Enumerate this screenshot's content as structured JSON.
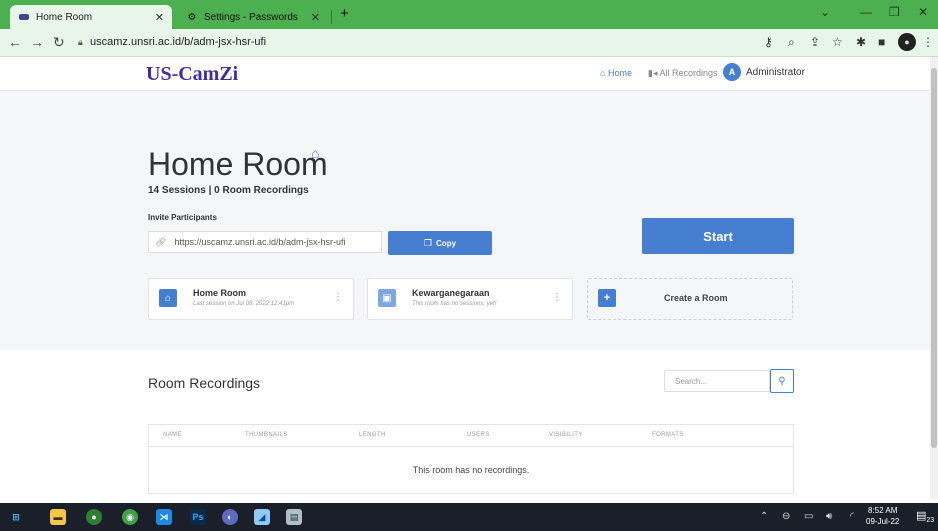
{
  "browser": {
    "tabs": [
      {
        "title": "Home Room",
        "active": true
      },
      {
        "title": "Settings - Passwords",
        "active": false
      }
    ],
    "url": "uscamz.unsri.ac.id/b/adm-jsx-hsr-ufi"
  },
  "header": {
    "logo": "US-CamZi",
    "nav": {
      "home": "Home",
      "recordings": "All Recordings",
      "avatar_initial": "A",
      "user": "Administrator"
    }
  },
  "room": {
    "title": "Home Room",
    "stats": "14 Sessions | 0 Room Recordings",
    "invite_label": "Invite Participants",
    "invite_link": "https://uscamz.unsri.ac.id/b/adm-jsx-hsr-ufi",
    "copy_label": "Copy",
    "start_label": "Start"
  },
  "room_cards": [
    {
      "name": "Home Room",
      "subtitle": "Last session on Jul 08, 2022 12:41pm"
    },
    {
      "name": "Kewarganegaraan",
      "subtitle": "This room has no sessions, yet!"
    }
  ],
  "create_room_label": "Create a Room",
  "recordings": {
    "title": "Room Recordings",
    "search_placeholder": "Search...",
    "columns": [
      "NAME",
      "THUMBNAILS",
      "LENGTH",
      "USERS",
      "VISIBILITY",
      "FORMATS"
    ],
    "empty_message": "This room has no recordings."
  },
  "taskbar": {
    "time": "8:52 AM",
    "date": "09-Jul-22",
    "notification_count": "23",
    "ps_label": "Ps"
  },
  "colors": {
    "accent": "#467fcf",
    "browser_frame": "#4caf50",
    "logo": "#3f2fa0"
  }
}
